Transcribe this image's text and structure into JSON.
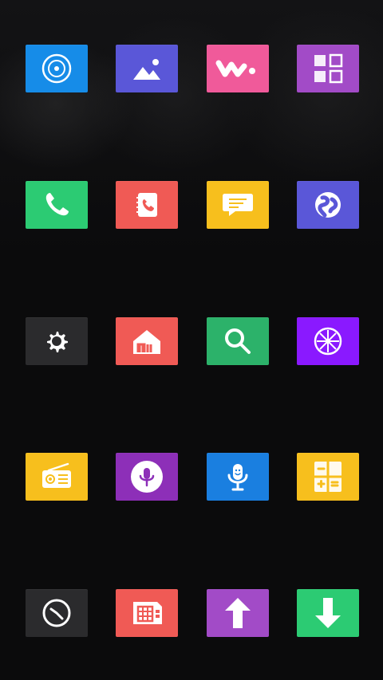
{
  "colors": {
    "background": "#0b0b0c",
    "blue": "#168ce8",
    "indigo": "#5a57d8",
    "pink": "#f05a9a",
    "purple": "#a24bc7",
    "green": "#2ccb73",
    "red": "#f05a55",
    "yellow": "#f7bf1d",
    "dark": "#2b2b2d",
    "violet": "#8a19ff"
  },
  "home_grid": {
    "rows": [
      [
        {
          "app": "disc",
          "icon": "disc-icon",
          "color": "blue"
        },
        {
          "app": "gallery",
          "icon": "image-icon",
          "color": "indigo"
        },
        {
          "app": "music-walkman",
          "icon": "walkman-icon",
          "color": "pink"
        },
        {
          "app": "apps-grid",
          "icon": "grid-icon",
          "color": "purple"
        }
      ],
      [
        {
          "app": "phone",
          "icon": "phone-icon",
          "color": "green"
        },
        {
          "app": "contacts",
          "icon": "contacts-icon",
          "color": "red"
        },
        {
          "app": "messages",
          "icon": "messages-icon",
          "color": "yellow"
        },
        {
          "app": "browser",
          "icon": "globe-icon",
          "color": "indigo"
        }
      ],
      [
        {
          "app": "settings",
          "icon": "gear-icon",
          "color": "dark"
        },
        {
          "app": "mi-home",
          "icon": "mi-home-icon",
          "color": "red"
        },
        {
          "app": "search",
          "icon": "search-icon",
          "color": "green"
        },
        {
          "app": "compass",
          "icon": "compass-icon",
          "color": "violet"
        }
      ],
      [
        {
          "app": "radio",
          "icon": "radio-icon",
          "color": "yellow"
        },
        {
          "app": "voice",
          "icon": "mic-circle-icon",
          "color": "purple"
        },
        {
          "app": "recorder",
          "icon": "mic-icon",
          "color": "blue"
        },
        {
          "app": "calculator",
          "icon": "calculator-icon",
          "color": "yellow"
        }
      ],
      [
        {
          "app": "clock",
          "icon": "clock-icon",
          "color": "dark"
        },
        {
          "app": "sim-toolkit",
          "icon": "sim-icon",
          "color": "red"
        },
        {
          "app": "updater",
          "icon": "arrow-up-icon",
          "color": "purple"
        },
        {
          "app": "downloads",
          "icon": "arrow-down-icon",
          "color": "green"
        }
      ]
    ]
  }
}
